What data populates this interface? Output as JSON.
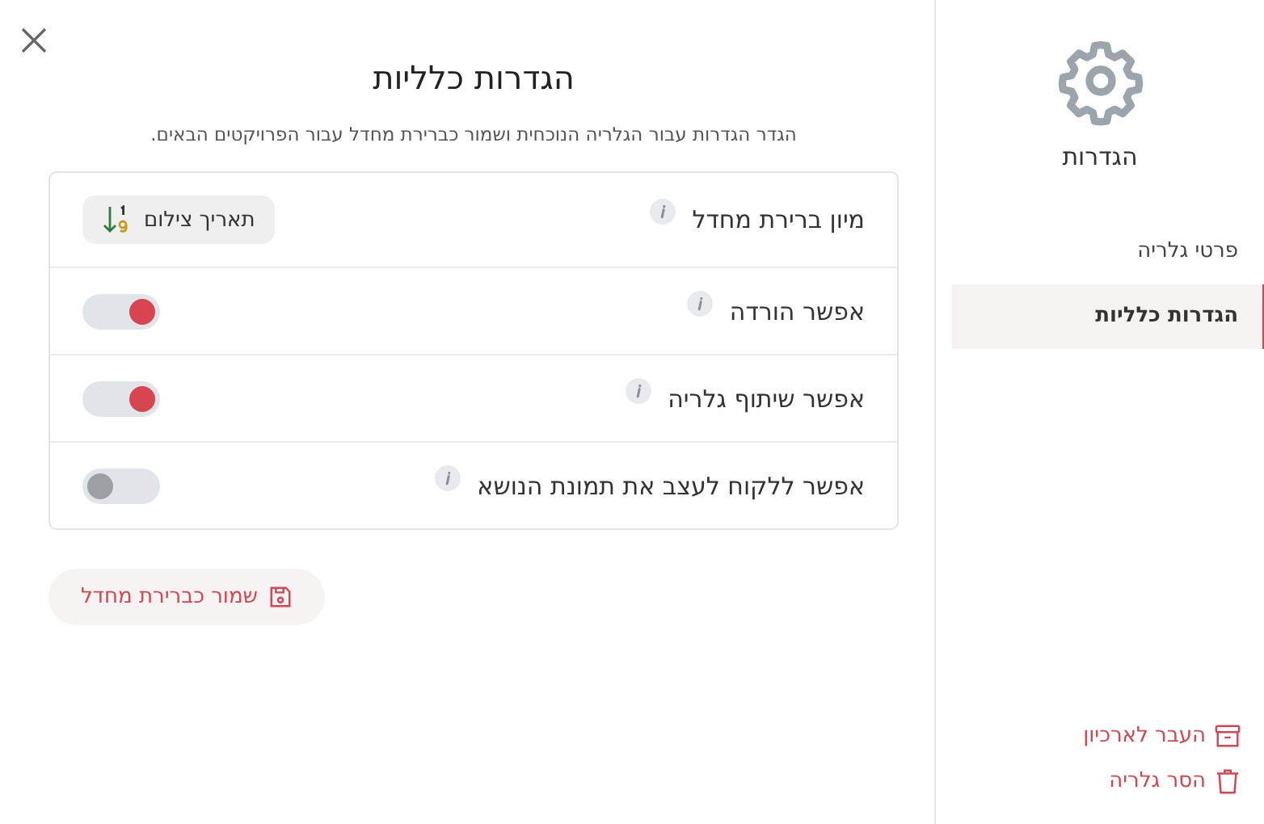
{
  "sidebar": {
    "title": "הגדרות",
    "items": [
      {
        "label": "פרטי גלריה",
        "selected": false
      },
      {
        "label": "הגדרות כלליות",
        "selected": true
      }
    ],
    "actions": [
      {
        "label": "העבר לארכיון",
        "kind": "archive"
      },
      {
        "label": "הסר גלריה",
        "kind": "trash"
      }
    ]
  },
  "main": {
    "title": "הגדרות כלליות",
    "description": "הגדר הגדרות עבור הגלריה הנוכחית ושמור כברירת מחדל עבור הפרויקטים הבאים.",
    "settings": [
      {
        "kind": "select",
        "label": "מיון ברירת מחדל",
        "value": "תאריך צילום"
      },
      {
        "kind": "toggle",
        "label": "אפשר הורדה",
        "on": true
      },
      {
        "kind": "toggle",
        "label": "אפשר שיתוף גלריה",
        "on": true
      },
      {
        "kind": "toggle",
        "label": "אפשר ללקוח לעצב את תמונת הנושא",
        "on": false
      }
    ],
    "save_button": "שמור כברירת מחדל"
  }
}
